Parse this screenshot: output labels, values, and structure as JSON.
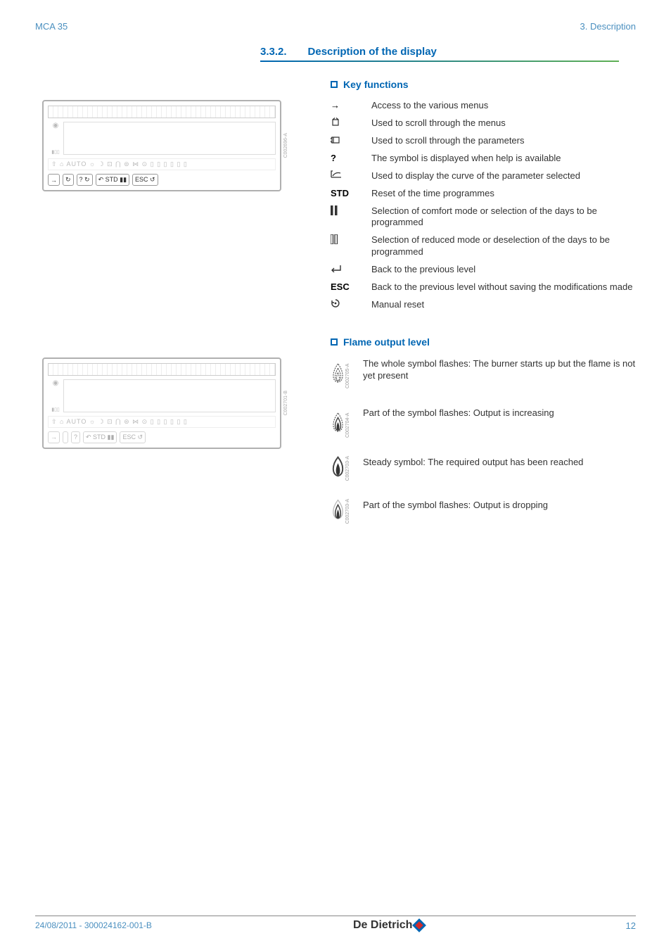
{
  "header": {
    "left": "MCA 35",
    "right": "3.  Description"
  },
  "section": {
    "num": "3.3.2.",
    "title": "Description of the display"
  },
  "sub1": "Key functions",
  "keys": [
    {
      "sym": "→",
      "bold": false,
      "desc": "Access to the various menus"
    },
    {
      "sym": "↻₁",
      "bold": false,
      "desc": "Used to scroll through the menus"
    },
    {
      "sym": "↻₂",
      "bold": false,
      "desc": "Used to scroll through the parameters"
    },
    {
      "sym": "?",
      "bold": true,
      "desc": "The symbol is displayed when help is available"
    },
    {
      "sym": "↶",
      "bold": false,
      "desc": "Used to display the curve of the parameter selected"
    },
    {
      "sym": "STD",
      "bold": true,
      "desc": "Reset of the time programmes"
    },
    {
      "sym": "▮▮",
      "bold": false,
      "desc": "Selection of comfort mode or selection of the days to be programmed"
    },
    {
      "sym": "▯▯",
      "bold": false,
      "desc": "Selection of reduced mode or deselection of the days to be programmed"
    },
    {
      "sym": "⤴",
      "bold": false,
      "desc": "Back to the previous level"
    },
    {
      "sym": "ESC",
      "bold": true,
      "desc": "Back to the previous level without saving the modifications made"
    },
    {
      "sym": "↺",
      "bold": false,
      "desc": "Manual reset"
    }
  ],
  "sub2": "Flame output level",
  "flames": [
    {
      "desc": "The whole symbol flashes: The burner starts up but the flame is not yet present",
      "code": "C002705-A",
      "style": "hatched"
    },
    {
      "desc": "Part of the symbol flashes: Output is increasing",
      "code": "C002704-A",
      "style": "half"
    },
    {
      "desc": "Steady symbol: The required output has been reached",
      "code": "C002703-A",
      "style": "solid"
    },
    {
      "desc": "Part of the symbol flashes: Output is dropping",
      "code": "C002703-A",
      "style": "fade"
    }
  ],
  "diag1": {
    "icons_row": "⇧ ⌂  AUTO ☼ ☽ ⊡ ⋂  ⊜ ⋈ ⊙ ▯ ▯ ▯ ▯ ▯ ▯",
    "side": "C002696-A",
    "keys": [
      {
        "label": "→"
      },
      {
        "label": "↻"
      },
      {
        "label": "? ↻"
      },
      {
        "label": "↶ STD ▮▮"
      },
      {
        "label": "ESC ↺"
      }
    ]
  },
  "diag2": {
    "icons_row": "⇧ ⌂  AUTO ☼ ☽ ⊡ ⋂  ⊜ ⋈ ⊙ ▯ ▯ ▯ ▯ ▯ ▯",
    "side": "C002701-B",
    "keys": [
      {
        "label": "→"
      },
      {
        "label": ""
      },
      {
        "label": "?"
      },
      {
        "label": "↶ STD ▮▮"
      },
      {
        "label": "ESC ↺"
      }
    ]
  },
  "footer": {
    "left": "24/08/2011  - 300024162-001-B",
    "logo": "De Dietrich",
    "page": "12"
  }
}
